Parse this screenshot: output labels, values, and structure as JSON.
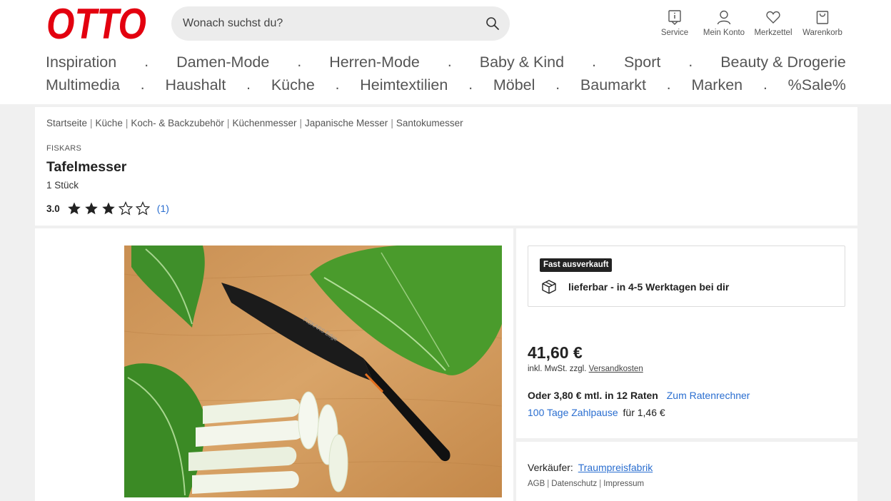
{
  "header": {
    "logo_text": "OTTO",
    "search": {
      "placeholder": "Wonach suchst du?"
    },
    "service_nav": [
      {
        "label": "Service",
        "icon": "info-icon"
      },
      {
        "label": "Mein Konto",
        "icon": "user-icon"
      },
      {
        "label": "Merkzettel",
        "icon": "heart-icon"
      },
      {
        "label": "Warenkorb",
        "icon": "cart-icon"
      }
    ],
    "nav_row1": [
      "Inspiration",
      "Damen-Mode",
      "Herren-Mode",
      "Baby & Kind",
      "Sport",
      "Beauty & Drogerie"
    ],
    "nav_row2": [
      "Multimedia",
      "Haushalt",
      "Küche",
      "Heimtextilien",
      "Möbel",
      "Baumarkt",
      "Marken",
      "%Sale%"
    ],
    "nav_separator": ".",
    "brand_color": "#e3000f"
  },
  "product": {
    "breadcrumb": [
      "Startseite",
      "Küche",
      "Koch- & Backzubehör",
      "Küchenmesser",
      "Japanische Messer",
      "Santokumesser"
    ],
    "breadcrumb_separator": "|",
    "brand": "FISKARS",
    "title": "Tafelmesser",
    "quantity": "1 Stück",
    "rating": {
      "score": "3.0",
      "stars_filled": 3,
      "stars_total": 5,
      "count": "(1)"
    },
    "image": {
      "knife_brand_text": "FISKARS Edge"
    }
  },
  "buy_box": {
    "badge": "Fast ausverkauft",
    "availability": "lieferbar - in 4-5 Werktagen bei dir",
    "price": "41,60 €",
    "tax_prefix": "inkl. MwSt. zzgl.",
    "shipping_link": "Versandkosten",
    "installment_text": "Oder 3,80 € mtl. in 12 Raten",
    "installment_link": "Zum Ratenrechner",
    "pause_link": "100 Tage Zahlpause",
    "pause_fee": "für 1,46 €",
    "link_color": "#2a6ed0"
  },
  "seller": {
    "label": "Verkäufer:",
    "name": "Traumpreisfabrik",
    "legal_links": [
      "AGB",
      "Datenschutz",
      "Impressum"
    ]
  }
}
